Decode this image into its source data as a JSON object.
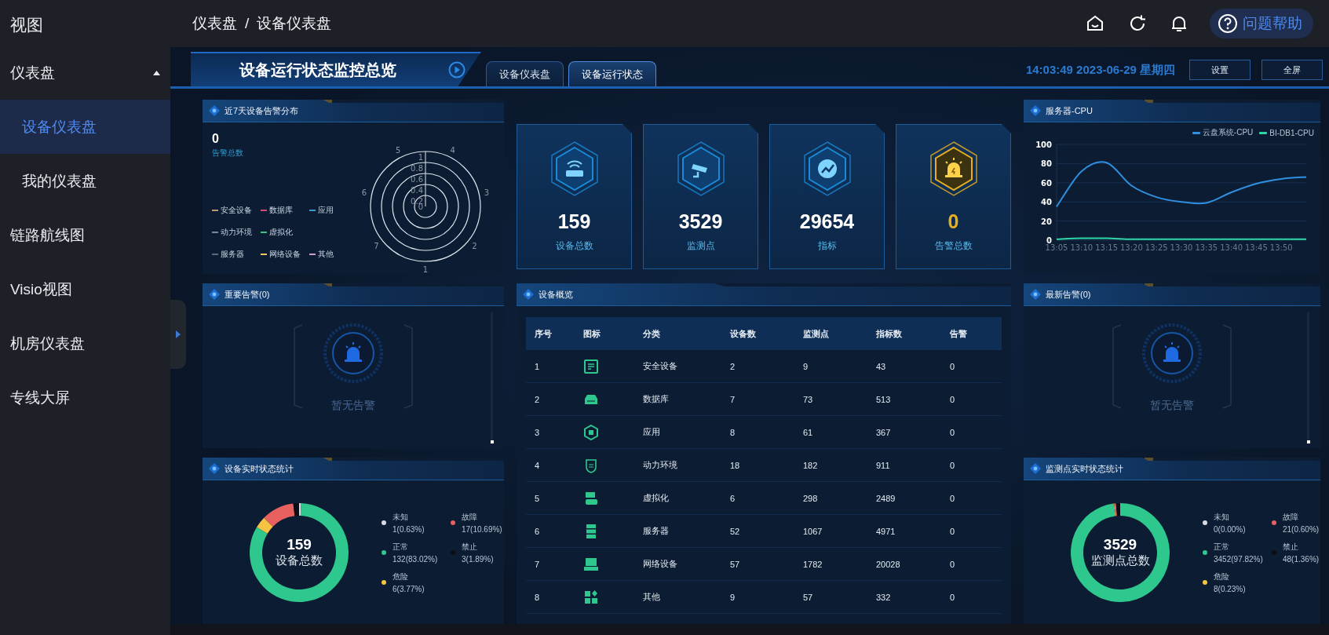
{
  "sidebar": {
    "title": "视图",
    "items": [
      {
        "label": "仪表盘",
        "selected": false,
        "expanded": true,
        "children": [
          {
            "label": "设备仪表盘",
            "selected": true
          },
          {
            "label": "我的仪表盘",
            "selected": false
          }
        ]
      },
      {
        "label": "链路航线图",
        "selected": false
      },
      {
        "label": "Visio视图",
        "selected": false
      },
      {
        "label": "机房仪表盘",
        "selected": false
      },
      {
        "label": "专线大屏",
        "selected": false
      }
    ]
  },
  "topbar": {
    "breadcrumb": [
      "仪表盘",
      "设备仪表盘"
    ],
    "separator": "/",
    "help_button": "问题帮助"
  },
  "header": {
    "title": "设备运行状态监控总览",
    "tabs": [
      {
        "label": "设备仪表盘",
        "selected": false
      },
      {
        "label": "设备运行状态",
        "selected": true
      }
    ],
    "clock": "14:03:49 2023-06-29 星期四",
    "buttons": [
      "设置",
      "全屏"
    ]
  },
  "alarm_distribution": {
    "title": "近7天设备告警分布",
    "total": "0",
    "total_label": "告警总数",
    "legend": [
      [
        {
          "label": "安全设备",
          "color": "#b89a70"
        },
        {
          "label": "数据库",
          "color": "#d04a7a"
        },
        {
          "label": "应用",
          "color": "#3a9ad0"
        }
      ],
      [
        {
          "label": "动力环境",
          "color": "#7a8898"
        },
        {
          "label": "虚拟化",
          "color": "#3ac080"
        }
      ],
      [
        {
          "label": "服务器",
          "color": "#5a6878"
        },
        {
          "label": "网络设备",
          "color": "#e8c860"
        },
        {
          "label": "其他",
          "color": "#c8a0c0"
        }
      ]
    ],
    "radar": {
      "ring_labels": [
        "1",
        "0.8",
        "0.6",
        "0.4",
        "0.2",
        "0"
      ],
      "axis_labels": [
        "1",
        "2",
        "3",
        "4",
        "5",
        "6",
        "7"
      ]
    }
  },
  "stats": [
    {
      "kind": "device",
      "value": "159",
      "label": "设备总数"
    },
    {
      "kind": "monitor",
      "value": "3529",
      "label": "监测点"
    },
    {
      "kind": "metric",
      "value": "29654",
      "label": "指标"
    },
    {
      "kind": "alarm",
      "value": "0",
      "label": "告警总数"
    }
  ],
  "cpu_panel": {
    "title": "服务器-CPU",
    "chart_data": {
      "type": "line",
      "grid": true,
      "categories": [
        "13:05",
        "13:10",
        "13:15",
        "13:20",
        "13:25",
        "13:30",
        "13:35",
        "13:40",
        "13:45",
        "13:50",
        null
      ],
      "ylim": [
        0,
        100
      ],
      "yticks": [
        0,
        20,
        40,
        60,
        80,
        100
      ],
      "series": [
        {
          "name": "云盘系统-CPU",
          "color": "#2f8fe0",
          "values": [
            35,
            72,
            81,
            57,
            45,
            40,
            39,
            50,
            59,
            64,
            66
          ]
        },
        {
          "name": "BI-DB1-CPU",
          "color": "#2fd6a8",
          "values": [
            1,
            2,
            2,
            1,
            1,
            1,
            1,
            1,
            1,
            1,
            1
          ]
        }
      ]
    }
  },
  "important_alarms": {
    "title": "重要告警(0)",
    "empty_text": "暂无告警"
  },
  "device_overview": {
    "title": "设备概览",
    "columns": [
      "序号",
      "图标",
      "分类",
      "设备数",
      "监测点",
      "指标数",
      "告警"
    ],
    "rows": [
      {
        "index": "1",
        "kind": "security",
        "category": "安全设备",
        "devices": "2",
        "points": "9",
        "metrics": "43",
        "alarms": "0"
      },
      {
        "index": "2",
        "kind": "database",
        "category": "数据库",
        "devices": "7",
        "points": "73",
        "metrics": "513",
        "alarms": "0"
      },
      {
        "index": "3",
        "kind": "app",
        "category": "应用",
        "devices": "8",
        "points": "61",
        "metrics": "367",
        "alarms": "0"
      },
      {
        "index": "4",
        "kind": "power",
        "category": "动力环境",
        "devices": "18",
        "points": "182",
        "metrics": "911",
        "alarms": "0"
      },
      {
        "index": "5",
        "kind": "virtual",
        "category": "虚拟化",
        "devices": "6",
        "points": "298",
        "metrics": "2489",
        "alarms": "0"
      },
      {
        "index": "6",
        "kind": "server",
        "category": "服务器",
        "devices": "52",
        "points": "1067",
        "metrics": "4971",
        "alarms": "0"
      },
      {
        "index": "7",
        "kind": "network",
        "category": "网络设备",
        "devices": "57",
        "points": "1782",
        "metrics": "20028",
        "alarms": "0"
      },
      {
        "index": "8",
        "kind": "other",
        "category": "其他",
        "devices": "9",
        "points": "57",
        "metrics": "332",
        "alarms": "0"
      }
    ]
  },
  "latest_alarms": {
    "title": "最新告警(0)",
    "empty_text": "暂无告警"
  },
  "device_status": {
    "title": "设备实时状态统计",
    "total": "159",
    "total_label": "设备总数",
    "chart_data": {
      "type": "donut",
      "values": [
        0.63,
        83.02,
        3.77,
        10.69,
        1.89
      ]
    },
    "legend": [
      {
        "label": "未知",
        "reading": "1(0.63%)",
        "color": "#d9dde3"
      },
      {
        "label": "正常",
        "reading": "132(83.02%)",
        "color": "#2ec88e"
      },
      {
        "label": "危险",
        "reading": "6(3.77%)",
        "color": "#f5c342"
      },
      {
        "label": "故障",
        "reading": "17(10.69%)",
        "color": "#e86060"
      },
      {
        "label": "禁止",
        "reading": "3(1.89%)",
        "color": "#0a0e14"
      }
    ]
  },
  "point_status": {
    "title": "监测点实时状态统计",
    "total": "3529",
    "total_label": "监测点总数",
    "chart_data": {
      "type": "donut",
      "values": [
        0,
        97.82,
        0.23,
        0.6,
        1.36
      ]
    },
    "legend": [
      {
        "label": "未知",
        "reading": "0(0.00%)",
        "color": "#d9dde3"
      },
      {
        "label": "正常",
        "reading": "3452(97.82%)",
        "color": "#2ec88e"
      },
      {
        "label": "危险",
        "reading": "8(0.23%)",
        "color": "#f5c342"
      },
      {
        "label": "故障",
        "reading": "21(0.60%)",
        "color": "#e86060"
      },
      {
        "label": "禁止",
        "reading": "48(1.36%)",
        "color": "#0a0e14"
      }
    ]
  }
}
